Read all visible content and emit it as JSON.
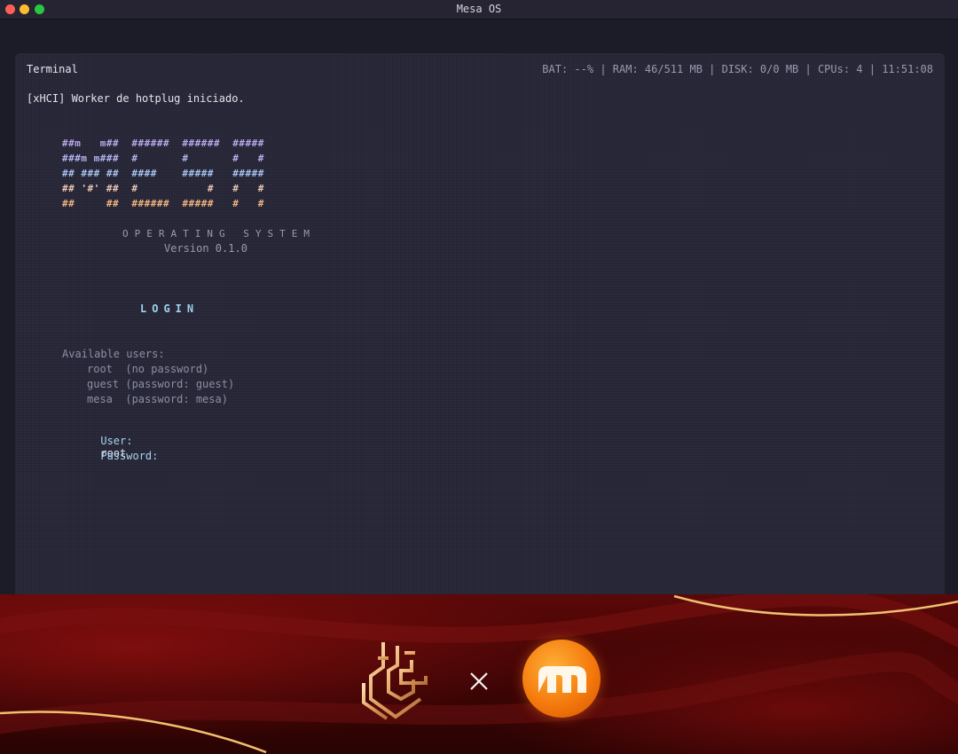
{
  "window": {
    "title": "Mesa OS"
  },
  "terminal": {
    "title": "Terminal",
    "status": "BAT: --% | RAM: 46/511 MB | DISK: 0/0 MB | CPUs: 4 | 11:51:08",
    "log_line": "[xHCI] Worker de hotplug iniciado.",
    "ascii_art": [
      "##m   m##  ######  ######  #####",
      "###m m###  #       #       #   #",
      "## ### ##  ####    #####   #####",
      "## '#' ##  #           #   #   #",
      "##     ##  ######  #####   #   #"
    ],
    "os_subtitle": "OPERATING SYSTEM",
    "version": "Version 0.1.0",
    "login_heading": "LOGIN",
    "users_heading": "Available users:",
    "users": [
      "root  (no password)",
      "guest (password: guest)",
      "mesa  (password: mesa)"
    ],
    "prompt_user_label": "User:",
    "prompt_user_value": "root",
    "prompt_password_label": "Password:"
  },
  "banner": {
    "separator": "×",
    "accent_colors": {
      "background": "#3a0404",
      "gold": "#f0c070",
      "orange": "#f47a0c"
    },
    "icons": [
      "crest-logo-icon",
      "close-x-icon",
      "orange-m-logo-icon"
    ]
  }
}
